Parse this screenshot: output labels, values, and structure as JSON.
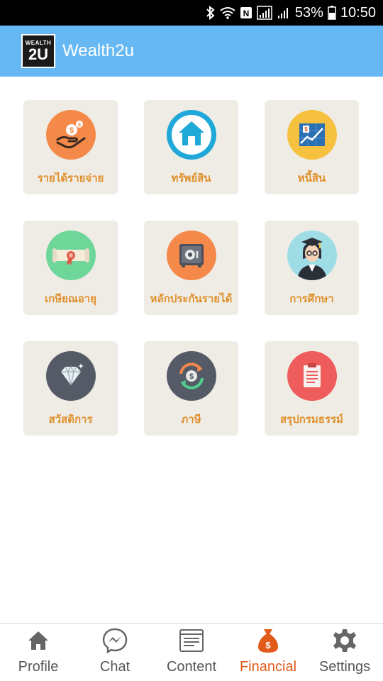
{
  "status_bar": {
    "battery": "53%",
    "time": "10:50"
  },
  "app_bar": {
    "logo_top": "WEALTH",
    "logo_bottom": "2U",
    "title": "Wealth2u"
  },
  "tiles": [
    {
      "label": "รายได้รายจ่าย",
      "icon": "income-expense-icon",
      "color": "#f5894a"
    },
    {
      "label": "ทรัพย์สิน",
      "icon": "house-icon",
      "color": "#1fa8d8"
    },
    {
      "label": "หนี้สิน",
      "icon": "debt-chart-icon",
      "color": "#f6c13e"
    },
    {
      "label": "เกษียณอายุ",
      "icon": "diploma-icon",
      "color": "#6fd69a"
    },
    {
      "label": "หลักประกันรายได้",
      "icon": "safe-icon",
      "color": "#f5894a"
    },
    {
      "label": "การศึกษา",
      "icon": "graduate-icon",
      "color": "#9edce6"
    },
    {
      "label": "สวัสดิการ",
      "icon": "diamond-icon",
      "color": "#555b66"
    },
    {
      "label": "ภาษี",
      "icon": "tax-cycle-icon",
      "color": "#555b66"
    },
    {
      "label": "สรุปกรมธรรม์",
      "icon": "clipboard-icon",
      "color": "#ee5c5c"
    }
  ],
  "bottom_nav": [
    {
      "label": "Profile",
      "icon": "home-icon",
      "active": false
    },
    {
      "label": "Chat",
      "icon": "messenger-icon",
      "active": false
    },
    {
      "label": "Content",
      "icon": "document-icon",
      "active": false
    },
    {
      "label": "Financial",
      "icon": "money-bag-icon",
      "active": true
    },
    {
      "label": "Settings",
      "icon": "gear-icon",
      "active": false
    }
  ],
  "colors": {
    "app_bar": "#66b8f4",
    "tile_bg": "#efece6",
    "tile_label": "#e0902a",
    "nav_active": "#e05a1a"
  }
}
